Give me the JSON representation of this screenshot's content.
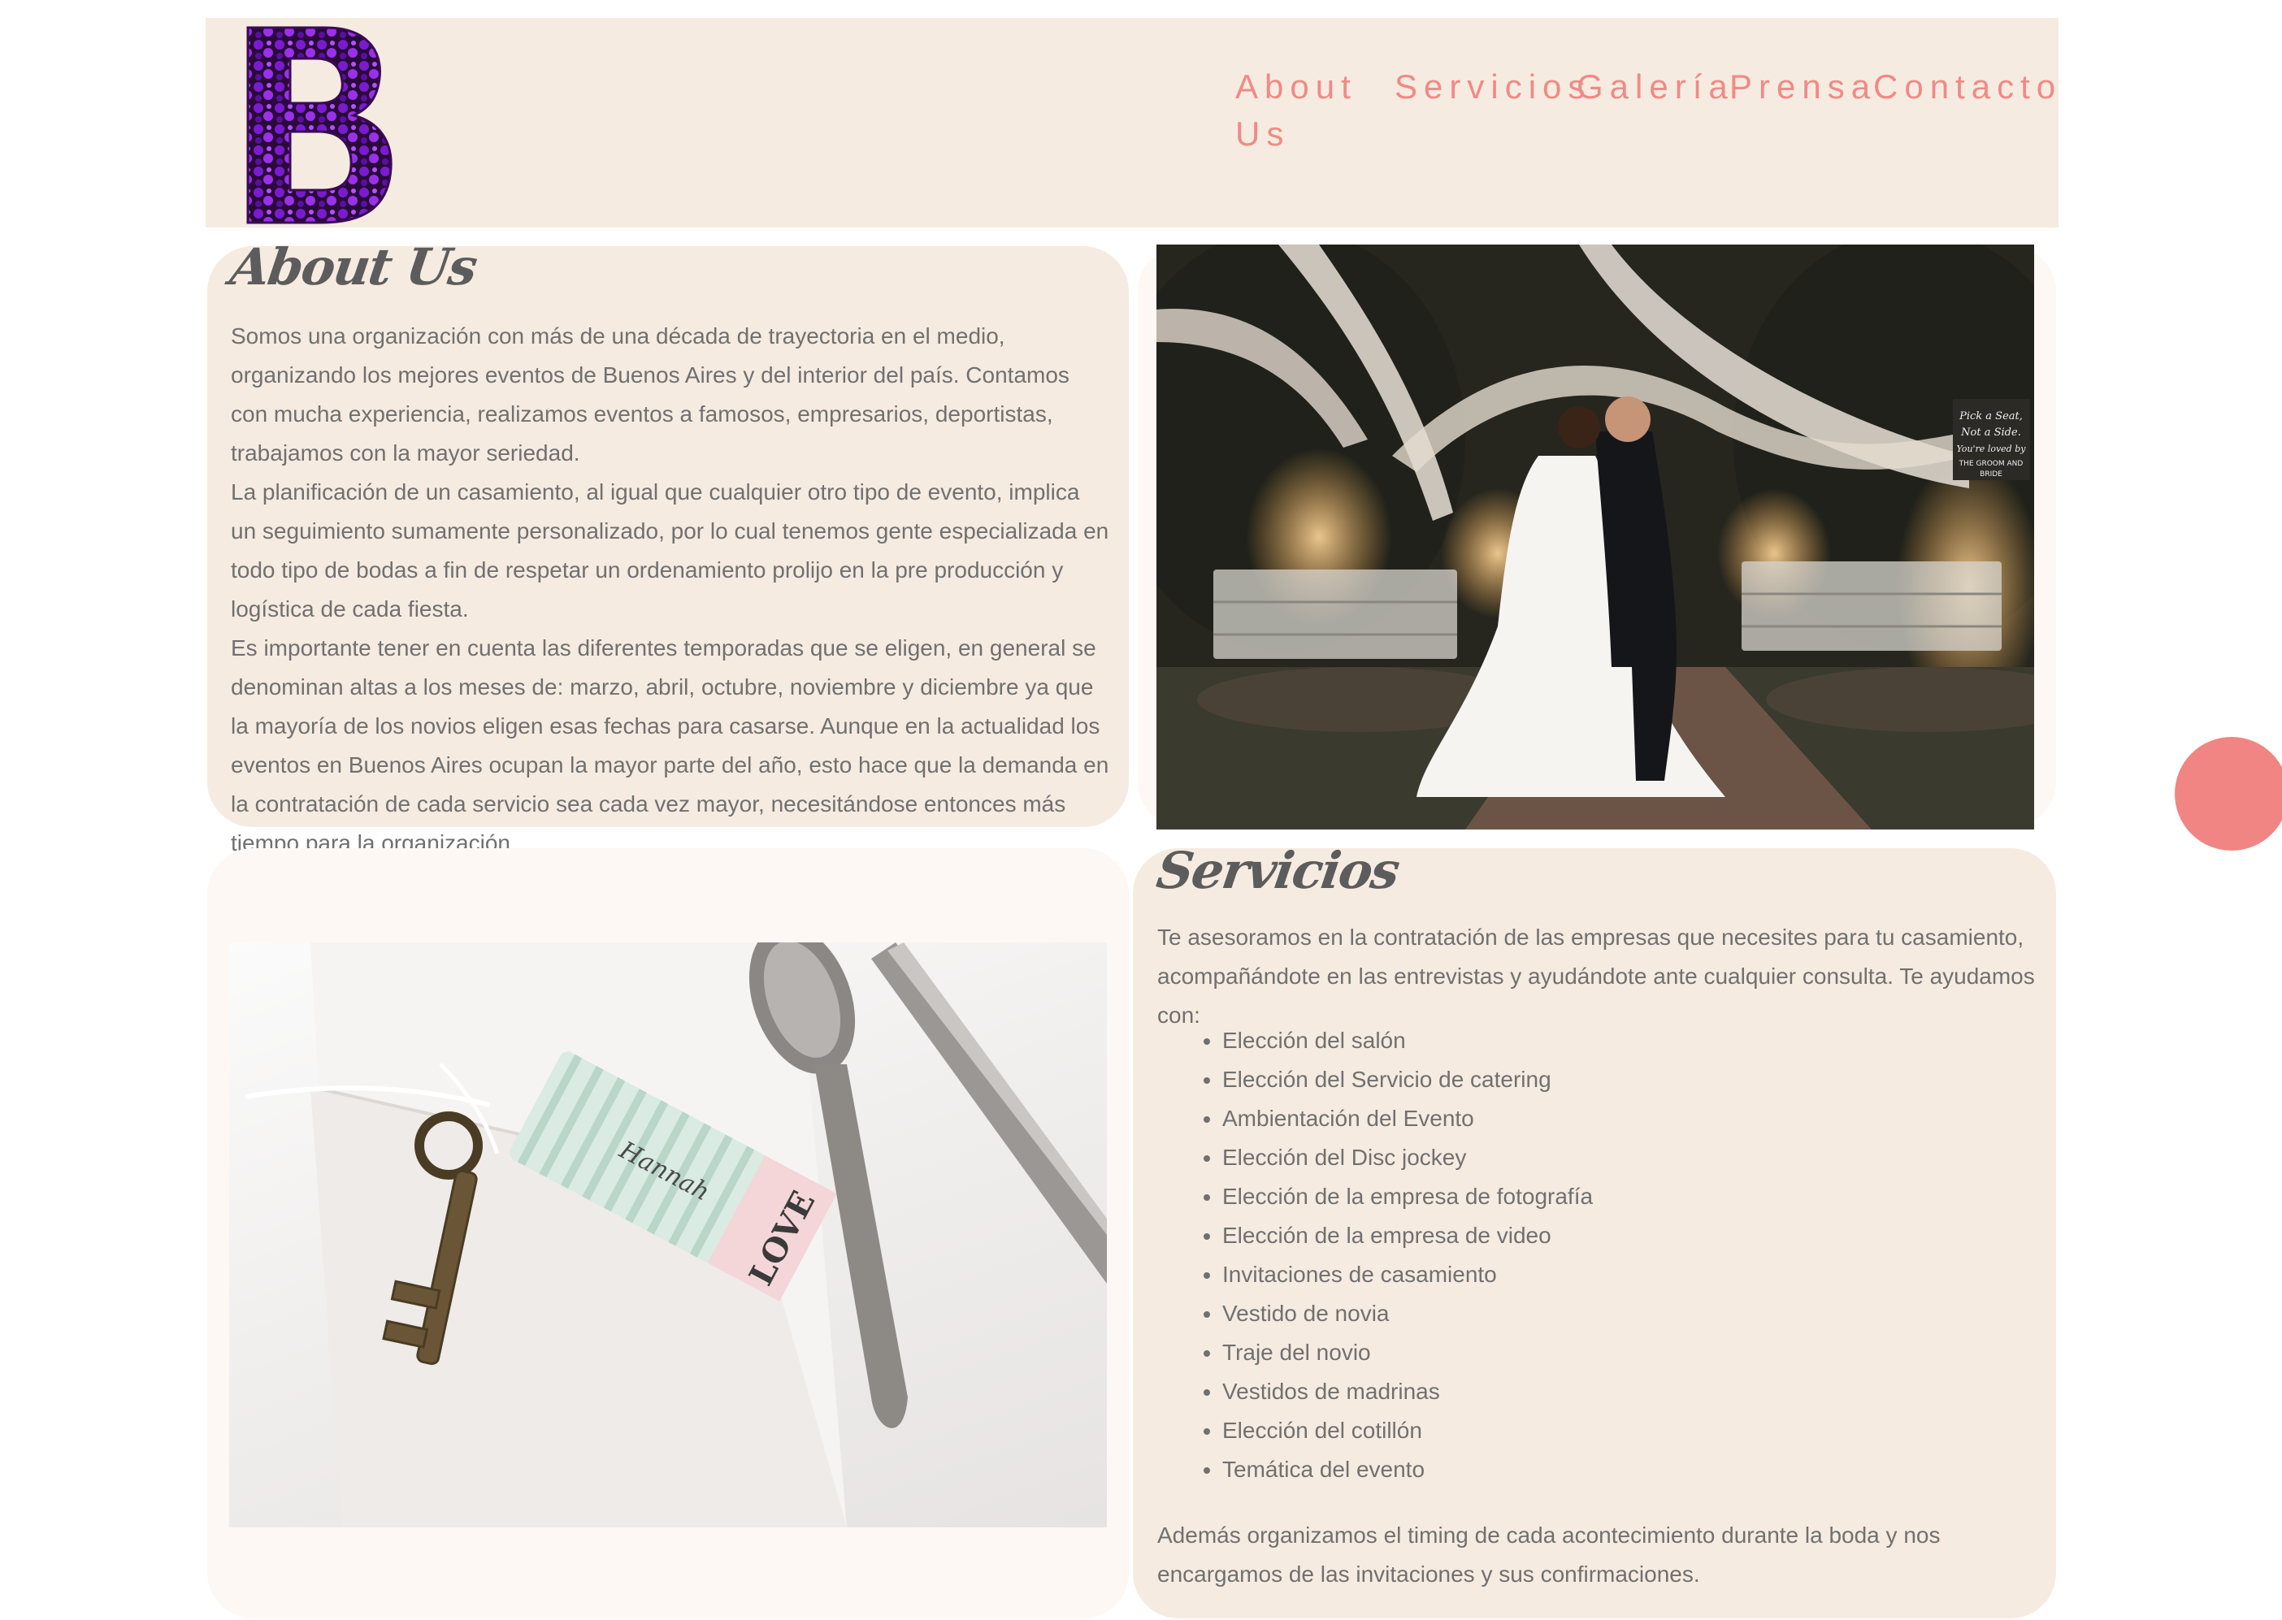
{
  "brand": {
    "logo_letter": "B",
    "logo_icon": "flower-letter-b-logo"
  },
  "nav": {
    "items": [
      {
        "label": "About Us"
      },
      {
        "label": "Servicios"
      },
      {
        "label": "Galería"
      },
      {
        "label": "Prensa"
      },
      {
        "label": "Contacto"
      }
    ]
  },
  "about": {
    "title": "About Us",
    "paragraphs": [
      "Somos una organización con más de una década de trayectoria en el medio, organizando los mejores eventos de Buenos Aires y del interior del país. Contamos con mucha experiencia, realizamos eventos a famosos, empresarios, deportistas, trabajamos con la mayor seriedad.",
      "La planificación de un casamiento, al igual que cualquier otro tipo de evento, implica un seguimiento sumamente personalizado, por lo cual tenemos gente especializada en todo tipo de bodas a fin de respetar un ordenamiento prolijo en la pre producción y logística de cada fiesta.",
      "Es importante tener en cuenta las diferentes temporadas que se eligen, en general se denominan altas a los meses de: marzo, abril, octubre, noviembre y diciembre ya que la mayoría de los novios eligen esas fechas para casarse. Aunque en la actualidad los eventos en Buenos Aires ocupan la mayor parte del año, esto hace que la demanda en la contratación de cada servicio sea cada vez mayor, necesitándose entonces más tiempo para la organización."
    ],
    "photo_sign": [
      "Pick a Seat,",
      "Not a Side.",
      "You're loved by",
      "THE GROOM AND",
      "BRIDE"
    ]
  },
  "services": {
    "title": "Servicios",
    "intro": "Te asesoramos en la contratación de las empresas que necesites para tu casamiento, acompañándote en las entrevistas y ayudándote ante cualquier consulta. Te ayudamos con:",
    "items": [
      "Elección del salón",
      "Elección del Servicio de catering",
      "Ambientación del Evento",
      "Elección del Disc jockey",
      "Elección de la empresa de fotografía",
      "Elección de la empresa de video",
      "Invitaciones de casamiento",
      "Vestido de novia",
      "Traje del novio",
      "Vestidos de madrinas",
      "Elección del cotillón",
      "Temática del evento"
    ],
    "outro": "Además organizamos el timing de cada acontecimiento durante la boda y nos encargamos de las invitaciones y sus confirmaciones.",
    "photo_tag_name": "Hannah",
    "photo_tag_word": "LOVE"
  },
  "colors": {
    "accent": "#f08a86",
    "panel": "#f6ebe1",
    "panel_light": "#fdf8f4",
    "text": "#707070"
  }
}
